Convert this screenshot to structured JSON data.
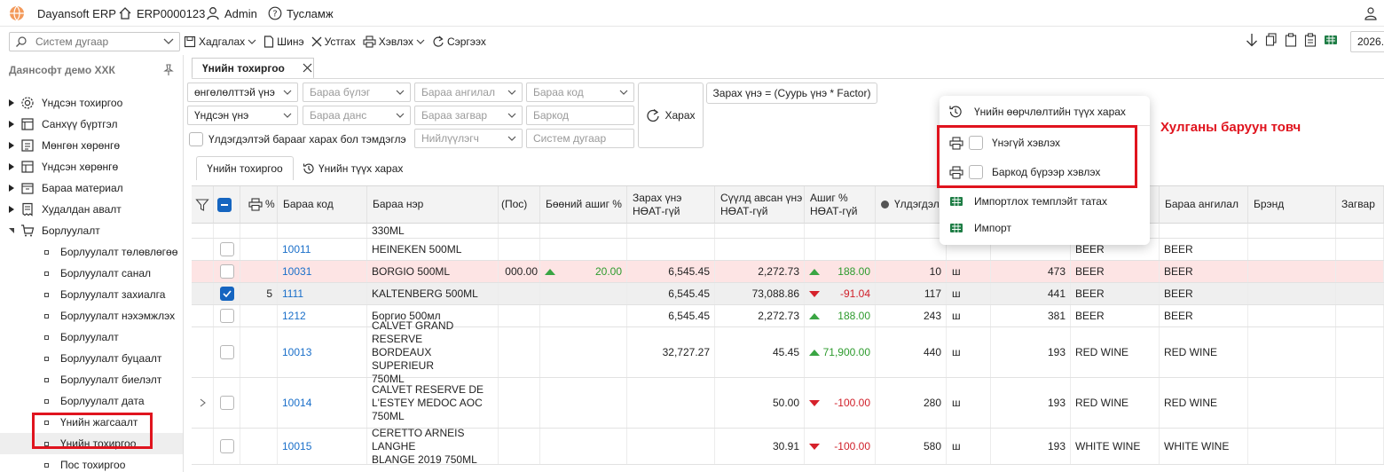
{
  "app": {
    "name": "Dayansoft ERP",
    "user": "ERP0000123",
    "role": "Admin",
    "help": "Тусламж",
    "date": "2026."
  },
  "sidebar": {
    "search_placeholder": "Систем дугаар",
    "company": "Даянсофт демо ХХК",
    "items": [
      {
        "label": "Үндсэн тохиргоо",
        "icon": "gear-icon"
      },
      {
        "label": "Санхүү бүртгэл",
        "icon": "ledger-icon"
      },
      {
        "label": "Мөнгөн хөрөнгө",
        "icon": "money-icon"
      },
      {
        "label": "Үндсэн хөрөнгө",
        "icon": "asset-icon"
      },
      {
        "label": "Бараа материал",
        "icon": "box-icon"
      },
      {
        "label": "Худалдан авалт",
        "icon": "receipt-icon"
      },
      {
        "label": "Борлуулалт",
        "icon": "cart-icon"
      }
    ],
    "sub_items": [
      "Борлуулалт төлөвлөгөө",
      "Борлуулалт санал",
      "Борлуулалт захиалга",
      "Борлуулалт нэхэмжлэх",
      "Борлуулалт",
      "Борлуулалт буцаалт",
      "Борлуулалт биелэлт",
      "Борлуулалт дата",
      "Үнийн жагсаалт",
      "Үнийн тохиргоо",
      "Пос тохиргоо"
    ]
  },
  "toolbar": {
    "save": "Хадгалах",
    "new": "Шинэ",
    "delete": "Устгах",
    "print": "Хэвлэх",
    "refresh": "Сэргээх"
  },
  "tab": {
    "label": "Үнийн тохиргоо"
  },
  "filters": {
    "f1": "өнгөлөлттэй үнэ",
    "f2": "Бараа бүлэг",
    "f3": "Бараа ангилал",
    "f4": "Бараа код",
    "f5": "Үндсэн үнэ",
    "f6": "Бараа данс",
    "f7": "Бараа загвар",
    "f8": "Баркод",
    "f9": "Нийлүүлэгч",
    "f10": "Систем дугаар",
    "check_label": "Үлдэгдэлтэй барааг харах бол тэмдэглэ",
    "view_button": "Харах",
    "formula": "Зарах үнэ = (Суурь үнэ * Factor)"
  },
  "subtabs": {
    "t1": "Үнийн тохиргоо",
    "t2": "Үнийн түүх харах"
  },
  "columns": {
    "pct": "%",
    "code": "Бараа код",
    "name": "Бараа нэр",
    "pos": "(Пос)",
    "wholesale": "Бөөний ашиг %",
    "sale1": "Зарах үнэ",
    "sale2": "НӨАТ-гүй",
    "last1": "Сүүлд авсан үнэ",
    "last2": "НӨАТ-гүй",
    "profit1": "Ашиг %",
    "profit2": "НӨАТ-гүй",
    "stock": "Үлдэгдэл",
    "category": "Бараа ангилал",
    "brand": "Брэнд",
    "model": "Загвар"
  },
  "rows": [
    {
      "code": "",
      "name": "330ML",
      "pos": "",
      "whole": "",
      "sale": "",
      "last": "",
      "profit": "",
      "stock": "",
      "unit": "",
      "qty": "",
      "g1": "",
      "g2": "",
      "checked": false,
      "pct": ""
    },
    {
      "code": "10011",
      "name": "HEINEKEN 500ML",
      "pos": "",
      "whole": "",
      "sale": "",
      "last": "",
      "profit": "",
      "stock": "",
      "unit": "",
      "qty": "",
      "g1": "BEER",
      "g2": "BEER",
      "checked": false,
      "pct": ""
    },
    {
      "code": "10031",
      "name": "BORGIO 500ML",
      "pos": "000.00",
      "whole": "20.00",
      "sale": "6,545.45",
      "last": "2,272.73",
      "profit": "188.00",
      "stock": "10",
      "unit": "ш",
      "qty": "473",
      "g1": "BEER",
      "g2": "BEER",
      "checked": false,
      "pct": ""
    },
    {
      "code": "1111",
      "name": "KALTENBERG 500ML",
      "pos": "",
      "whole": "",
      "sale": "6,545.45",
      "last": "73,088.86",
      "profit": "-91.04",
      "stock": "117",
      "unit": "ш",
      "qty": "441",
      "g1": "BEER",
      "g2": "BEER",
      "checked": true,
      "pct": "5"
    },
    {
      "code": "1212",
      "name": "Боргио 500мл",
      "pos": "",
      "whole": "",
      "sale": "6,545.45",
      "last": "2,272.73",
      "profit": "188.00",
      "stock": "243",
      "unit": "ш",
      "qty": "381",
      "g1": "BEER",
      "g2": "BEER",
      "checked": false,
      "pct": ""
    },
    {
      "code": "10013",
      "name1": "CALVET GRAND RESERVE",
      "name2": "BORDEAUX SUPERIEUR",
      "name3": "750ML",
      "pos": "",
      "whole": "",
      "sale": "32,727.27",
      "last": "45.45",
      "profit": "71,900.00",
      "stock": "440",
      "unit": "ш",
      "qty": "193",
      "g1": "RED WINE",
      "g2": "RED WINE",
      "checked": false,
      "pct": ""
    },
    {
      "code": "10014",
      "name1": "CALVET RESERVE DE",
      "name2": "L'ESTEY MEDOC AOC",
      "name3": "750ML",
      "pos": "",
      "whole": "",
      "sale": "",
      "last": "50.00",
      "profit": "-100.00",
      "stock": "280",
      "unit": "ш",
      "qty": "193",
      "g1": "RED WINE",
      "g2": "RED WINE",
      "checked": false,
      "pct": ""
    },
    {
      "code": "10015",
      "name1": "CERETTO ARNEIS LANGHE",
      "name2": "BLANGE 2019 750ML",
      "pos": "",
      "whole": "",
      "sale": "",
      "last": "30.91",
      "profit": "-100.00",
      "stock": "580",
      "unit": "ш",
      "qty": "193",
      "g1": "WHITE WINE",
      "g2": "WHITE WINE",
      "checked": false,
      "pct": ""
    }
  ],
  "context_menu": {
    "history": "Үнийн өөрчлөлтийн түүх харах",
    "print_price": "Үнэгүй хэвлэх",
    "print_barcode": "Баркод бүрээр хэвлэх",
    "import_template": "Импортлох темплэйт татах",
    "import": "Импорт"
  },
  "annotation": "Хулганы баруун товч",
  "colors": {
    "accent": "#1565c0",
    "link": "#1a6fc9",
    "highlight_row": "#fde4e4",
    "selected_row": "#efefef",
    "annotation": "#e0141e"
  }
}
